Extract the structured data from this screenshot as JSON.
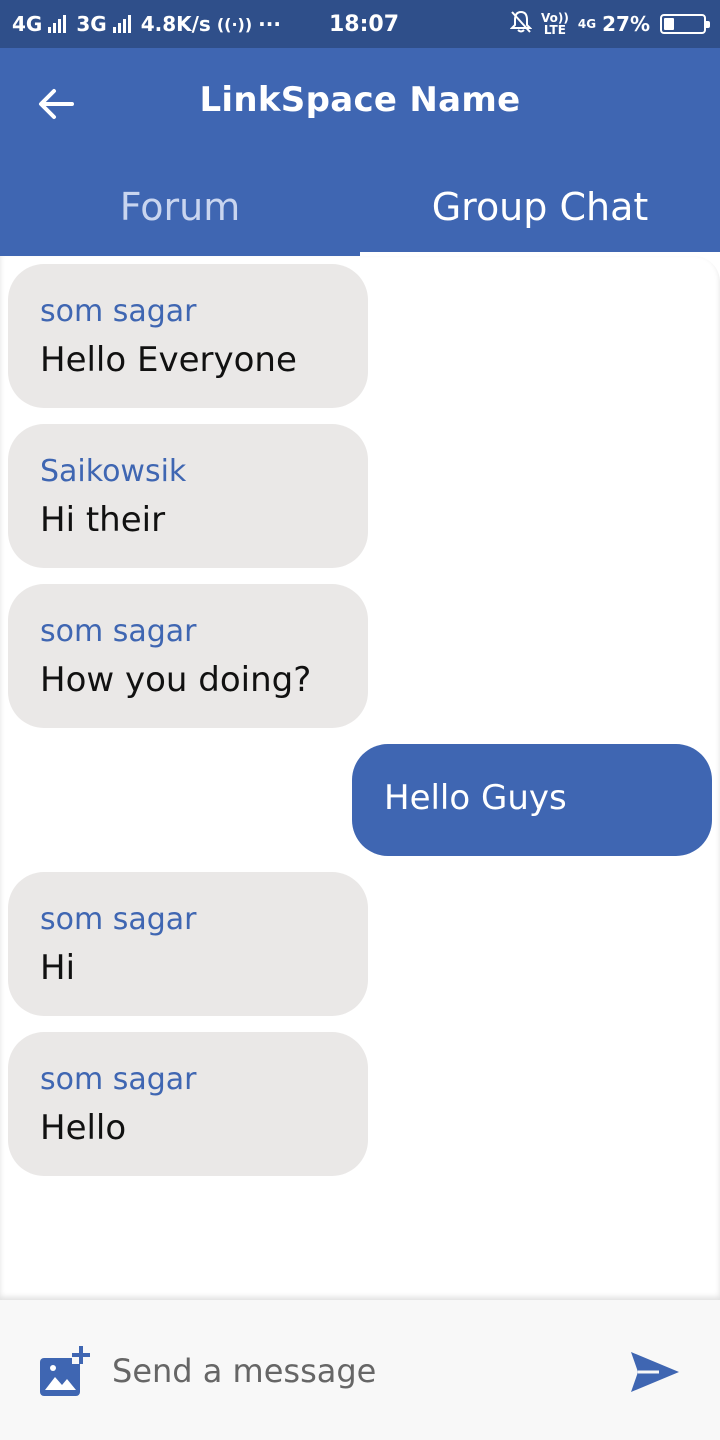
{
  "status_bar": {
    "network_1": "4G",
    "network_2": "3G",
    "speed": "4.8K/s",
    "dots": "···",
    "time": "18:07",
    "volte": "Vo)) LTE",
    "network_3": "4G",
    "battery_percent": "27%",
    "battery_level": 0.27
  },
  "app_bar": {
    "title": "LinkSpace Name",
    "tabs": [
      {
        "label": "Forum",
        "active": false
      },
      {
        "label": "Group Chat",
        "active": true
      }
    ]
  },
  "messages": [
    {
      "direction": "in",
      "sender": "som sagar",
      "text": "Hello Everyone"
    },
    {
      "direction": "in",
      "sender": "Saikowsik",
      "text": "Hi their"
    },
    {
      "direction": "in",
      "sender": "som sagar",
      "text": "How you doing?"
    },
    {
      "direction": "out",
      "sender": "",
      "text": "Hello Guys"
    },
    {
      "direction": "in",
      "sender": "som sagar",
      "text": "Hi"
    },
    {
      "direction": "in",
      "sender": "som sagar",
      "text": "Hello"
    }
  ],
  "composer": {
    "placeholder": "Send a message",
    "add_image_icon": "add-photo-icon",
    "send_icon": "send-icon"
  },
  "colors": {
    "primary": "#3f66b2",
    "status_bar": "#2f4f8a",
    "incoming_bubble": "#eae8e7",
    "sender_name": "#3f66b2"
  }
}
